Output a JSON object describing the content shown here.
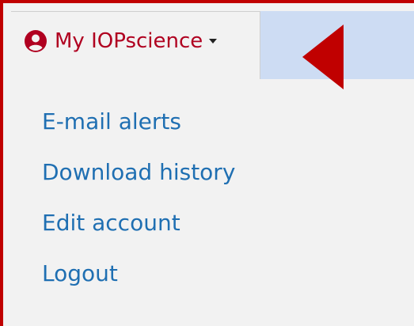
{
  "header": {
    "account_label": "My IOPscience"
  },
  "menu": {
    "items": [
      {
        "label": "E-mail alerts"
      },
      {
        "label": "Download history"
      },
      {
        "label": "Edit account"
      },
      {
        "label": "Logout"
      }
    ]
  },
  "icons": {
    "account": "user-circle-icon",
    "dropdown": "caret-down-icon",
    "pointer": "red-arrow-left-icon"
  },
  "colors": {
    "frame": "#c00000",
    "account_text": "#b00020",
    "link": "#1f6fb2",
    "highlight": "#cddcf3",
    "arrow": "#c00000",
    "panel_bg": "#f2f2f2"
  }
}
